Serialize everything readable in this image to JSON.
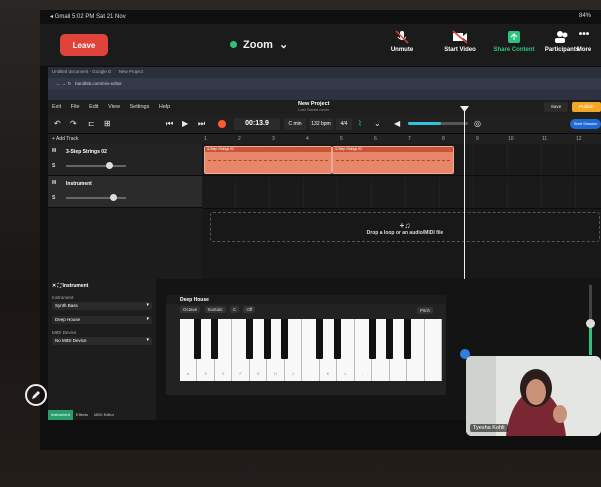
{
  "status": {
    "left": "◂ Gmail  5:02 PM  Sat 21 Nov",
    "battery": "84%"
  },
  "zoom": {
    "leave": "Leave",
    "title": "Zoom",
    "tools": [
      {
        "label": "Unmute",
        "icon": "mic-muted-icon"
      },
      {
        "label": "Start Video",
        "icon": "video-off-icon"
      },
      {
        "label": "Share Content",
        "icon": "share-icon"
      },
      {
        "label": "Participants",
        "icon": "participants-icon"
      },
      {
        "label": "More",
        "icon": "more-icon"
      }
    ],
    "accent": "#2ec27e",
    "leave_color": "#e0433a"
  },
  "browser": {
    "tab1": "Untitled document - Google D",
    "tab2": "New Project",
    "url": "bandlab.com/mix-editor"
  },
  "app": {
    "menu": [
      "Exit",
      "File",
      "Edit",
      "View",
      "Settings",
      "Help"
    ],
    "project_title": "New Project",
    "project_sub": "Last Saved never",
    "save": "Save",
    "publish": "Publish",
    "time": "00:13.9",
    "key": "C min",
    "bpm": "132 bpm",
    "signature": "4/4",
    "share": "Start Session",
    "volume_fraction": 0.55,
    "add_track": "+ Add Track"
  },
  "tracks": [
    {
      "m": "M",
      "s": "S",
      "name": "3-Step Strings 02"
    },
    {
      "m": "M",
      "s": "S",
      "name": "Instrument"
    }
  ],
  "ruler": [
    "1",
    "2",
    "3",
    "4",
    "5",
    "6",
    "7",
    "8",
    "9",
    "10",
    "11",
    "12"
  ],
  "clips": [
    {
      "label": "3-Step Strings 02"
    },
    {
      "label": "3-Step Strings 02"
    }
  ],
  "drop_text": "Drop a loop or an audio/MIDI file",
  "instrument": {
    "header": "Instrument",
    "section": "Instrument",
    "synth": "Synth Bass",
    "preset": "Deep House",
    "midi_label": "MIDI Device",
    "midi": "No MIDI Device",
    "tabs": [
      "Instrument",
      "Effects",
      "MIDI Editor"
    ],
    "piano_title": "Deep House",
    "octave": "Octave",
    "sustain": "Sustain",
    "note": "C",
    "off": "Off",
    "pitch": "Pitch"
  },
  "white_keys": [
    "A",
    "S",
    "D",
    "F",
    "G",
    "H",
    "J",
    "",
    "K",
    "L",
    ";",
    "",
    "",
    "",
    ""
  ],
  "self_view": {
    "name": "Tyesha Kohli"
  }
}
